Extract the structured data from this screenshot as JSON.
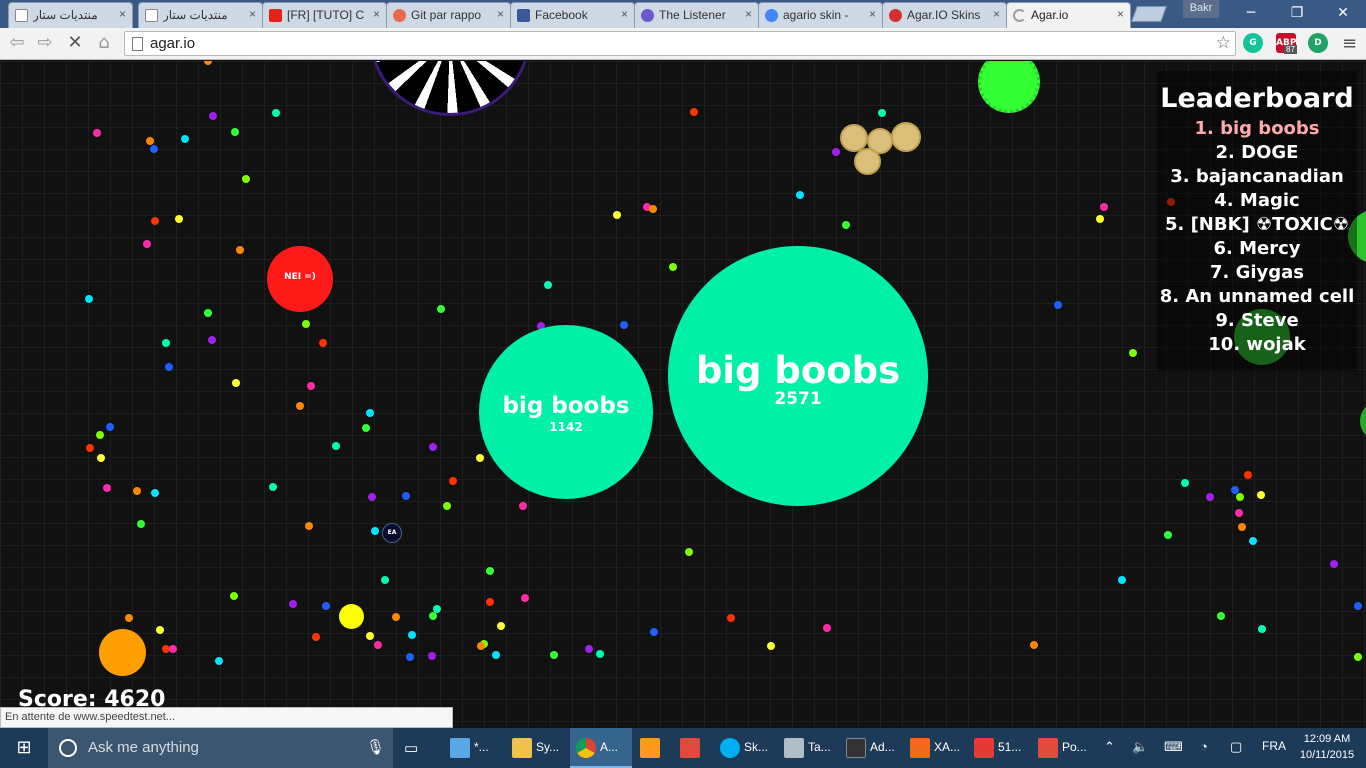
{
  "browser": {
    "tabs": [
      {
        "title": "منتديات ستار",
        "icon": "doc-icon",
        "color": "#ffffff"
      },
      {
        "title": "منتديات ستار",
        "icon": "doc-icon",
        "color": "#ffffff"
      },
      {
        "title": "[FR] [TUTO] C",
        "icon": "youtube-icon",
        "color": "#e62117"
      },
      {
        "title": "Git par rappo",
        "icon": "git-icon",
        "color": "#e96b4c"
      },
      {
        "title": "Facebook",
        "icon": "facebook-icon",
        "color": "#3b5998"
      },
      {
        "title": "The Listener",
        "icon": "listener-icon",
        "color": "#6a5acd"
      },
      {
        "title": "agario skin -",
        "icon": "google-icon",
        "color": "#4285f4"
      },
      {
        "title": "Agar.IO Skins",
        "icon": "red-dot-icon",
        "color": "#d32f2f"
      },
      {
        "title": "Agar.io",
        "icon": "loading-icon",
        "color": "#9e9e9e"
      }
    ],
    "profile_name": "Bakr",
    "url": "agar.io",
    "extensions": [
      {
        "name": "grammarly-icon",
        "label": "",
        "color": "#15c39a"
      },
      {
        "name": "adblock-plus-icon",
        "label": "ABP",
        "badge": "87",
        "color": "#c70d2c"
      },
      {
        "name": "d-extension-icon",
        "label": "D",
        "color": "#1fa463"
      }
    ],
    "status_text": "En attente de www.speedtest.net..."
  },
  "game": {
    "leaderboard_title": "Leaderboard",
    "leaderboard": [
      "1. big boobs",
      "2. DOGE",
      "3. bajancanadian",
      "4. Magic",
      "5. [NBK] ☢TOXIC☢",
      "6. Mercy",
      "7. Giygas",
      "8. An unnamed cell",
      "9. Steve",
      "10. wojak"
    ],
    "score_text": "Score: 4620",
    "player_cells": [
      {
        "name": "big boobs",
        "mass": "2571",
        "color": "#00f0a8"
      },
      {
        "name": "big boobs",
        "mass": "1142",
        "color": "#00f0a8"
      }
    ],
    "other_cells": [
      {
        "name": "NEI =)",
        "color": "#ff1a1a"
      },
      {
        "name": "EA",
        "color": "#0a0a2a"
      },
      {
        "name": "",
        "color": "#33ff33"
      },
      {
        "name": "",
        "color": "#ffa000"
      },
      {
        "name": "",
        "color": "#ffff00"
      }
    ]
  },
  "taskbar": {
    "search_placeholder": "Ask me anything",
    "apps": [
      {
        "label": "*...",
        "color": "#5aa7e8"
      },
      {
        "label": "Sy...",
        "color": "#f2c14b"
      },
      {
        "label": "A...",
        "color": "#e8e8e8"
      },
      {
        "label": "",
        "color": "#ff9a1f"
      },
      {
        "label": "",
        "color": "#e04a3a"
      },
      {
        "label": "Sk...",
        "color": "#00aff0"
      },
      {
        "label": "Ta...",
        "color": "#b0bec5"
      },
      {
        "label": "Ad...",
        "color": "#333333"
      },
      {
        "label": "XA...",
        "color": "#f26b1d"
      },
      {
        "label": "51...",
        "color": "#e53935"
      },
      {
        "label": "Po...",
        "color": "#e04a3a"
      }
    ],
    "language": "FRA",
    "time": "12:09 AM",
    "date": "10/11/2015"
  }
}
